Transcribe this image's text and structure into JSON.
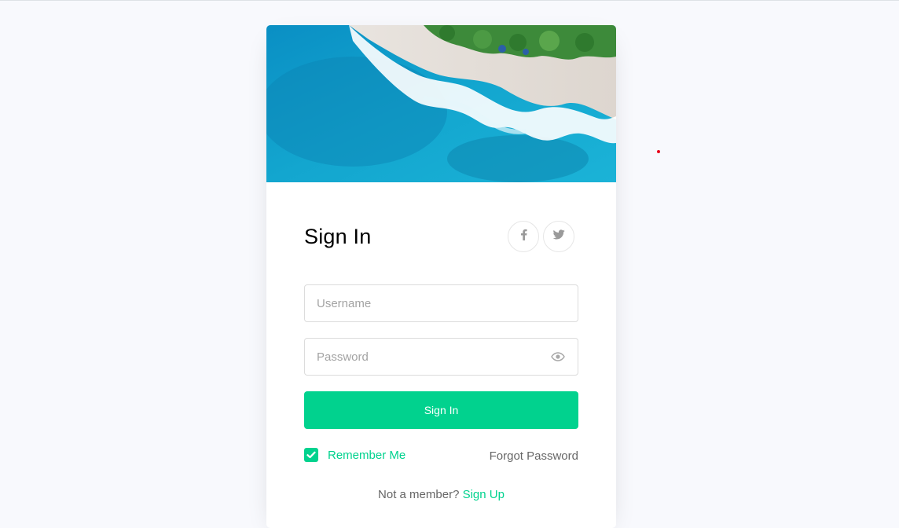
{
  "colors": {
    "accent": "#01d28e",
    "page_background": "#f8f9fd",
    "card_background": "#ffffff",
    "muted_text": "#666666"
  },
  "hero": {
    "image": "aerial-beach-ocean-image"
  },
  "login": {
    "title": "Sign In",
    "social": [
      {
        "name": "facebook-icon"
      },
      {
        "name": "twitter-icon"
      }
    ],
    "username": {
      "placeholder": "Username",
      "value": ""
    },
    "password": {
      "placeholder": "Password",
      "value": "",
      "toggle_icon": "eye-icon"
    },
    "submit_label": "Sign In",
    "remember": {
      "label": "Remember Me",
      "checked": true
    },
    "forgot_label": "Forgot Password",
    "signup_prompt": "Not a member?",
    "signup_link": "Sign Up"
  }
}
